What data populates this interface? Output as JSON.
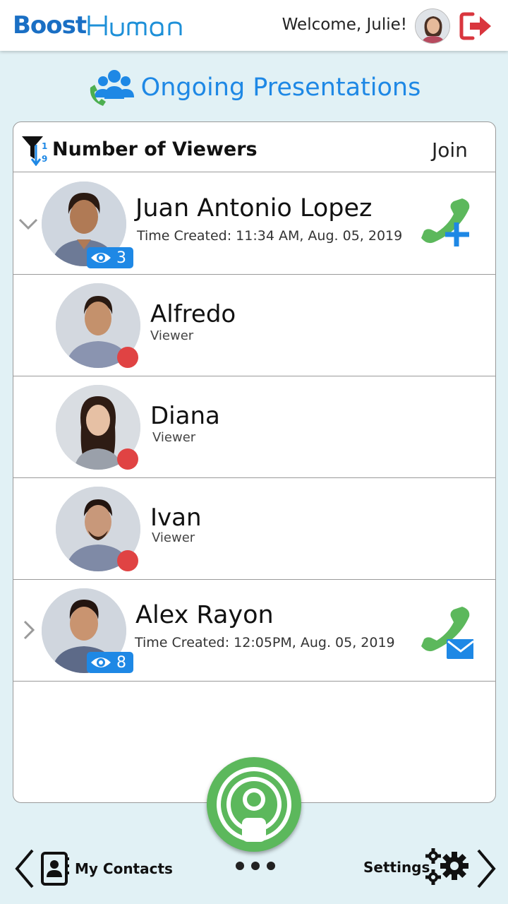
{
  "header": {
    "logo_boost": "Boost",
    "logo_human": "Human",
    "welcome": "Welcome, Julie!"
  },
  "page": {
    "title": "Ongoing Presentations"
  },
  "list": {
    "sort_label": "Number of Viewers",
    "join_label": "Join",
    "presentations": [
      {
        "host": "Juan Antonio Lopez",
        "time": "Time Created: 11:34 AM, Aug. 05, 2019",
        "viewer_count": "3",
        "expanded": true,
        "viewers": [
          {
            "name": "Alfredo",
            "role": "Viewer"
          },
          {
            "name": "Diana",
            "role": "Viewer"
          },
          {
            "name": "Ivan",
            "role": "Viewer"
          }
        ]
      },
      {
        "host": "Alex Rayon",
        "time": "Time Created: 12:05PM, Aug. 05, 2019",
        "viewer_count": "8",
        "expanded": false
      }
    ]
  },
  "bottom": {
    "contacts_label": "My Contacts",
    "settings_label": "Settings"
  },
  "colors": {
    "background": "#e1f1f5",
    "accent_blue": "#1e88e5",
    "call_green": "#5cb85c",
    "status_red": "#e04343",
    "logout_red": "#d9363e"
  },
  "icons": [
    "logout-icon",
    "group-call-icon",
    "sort-filter-icon",
    "chevron-down-icon",
    "chevron-right-icon",
    "eye-icon",
    "phone-add-icon",
    "phone-mail-icon",
    "contacts-book-icon",
    "gears-icon",
    "broadcast-icon"
  ]
}
